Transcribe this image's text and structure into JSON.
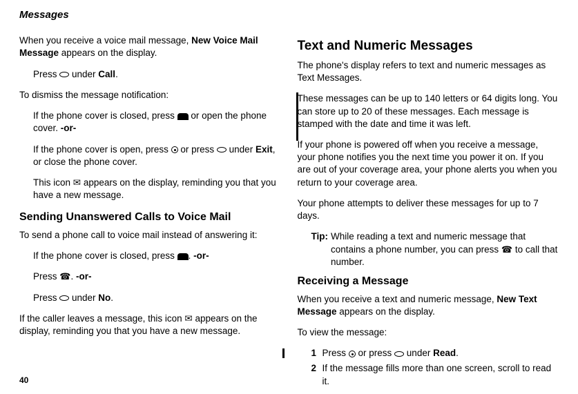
{
  "header": "Messages",
  "left": {
    "p1_a": "When you receive a voice mail message, ",
    "p1_b": "New Voice Mail Message",
    "p1_c": " appears on the display.",
    "l1_a": "Press ",
    "l1_b": " under ",
    "l1_c": "Call",
    "l1_d": ".",
    "p2": "To dismiss the message notification:",
    "l2_a": "If the phone cover is closed, press ",
    "l2_b": " or open the phone cover. ",
    "l2_or": "-or-",
    "l3_a": "If the phone cover is open, press ",
    "l3_b": " or press ",
    "l3_c": " under ",
    "l3_d": "Exit",
    "l3_e": ", or close the phone cover.",
    "l4_a": "This icon ",
    "l4_b": " appears on the display, reminding you that you have a new message.",
    "h2": "Sending Unanswered Calls to Voice Mail",
    "p3": "To send a phone call to voice mail instead of answering it:",
    "l5_a": "If the phone cover is closed, press ",
    "l5_b": ". ",
    "l5_or": "-or-",
    "l6_a": "Press ",
    "l6_b": ". ",
    "l6_or": "-or-",
    "l7_a": "Press ",
    "l7_b": " under ",
    "l7_c": "No",
    "l7_d": ".",
    "p4_a": "If the caller leaves a message, this icon ",
    "p4_b": " appears on the display, reminding you that you have a new message."
  },
  "right": {
    "h1": "Text and Numeric Messages",
    "p1": "The phone's display refers to text and numeric messages as Text Messages.",
    "p2": "These messages can be up to 140 letters or 64 digits long. You can store up to 20 of these messages. Each message is stamped with the date and time it was left.",
    "p3": "If your phone is powered off when you receive a message, your phone notifies you the next time you power it on. If you are out of your coverage area, your phone alerts you when you return to your coverage area.",
    "p4": "Your phone attempts to deliver these messages for up to 7 days.",
    "tip_label": "Tip:",
    "tip_a": "While reading a text and numeric message that contains a phone number, you can press ",
    "tip_b": " to call that number.",
    "h2": "Receiving a Message",
    "p5_a": "When you receive a text and numeric message, ",
    "p5_b": "New Text Message",
    "p5_c": " appears on the display.",
    "p6": "To view the message:",
    "step1_a": "Press ",
    "step1_b": " or press ",
    "step1_c": " under ",
    "step1_d": "Read",
    "step1_e": ".",
    "step2": "If the message fills more than one screen, scroll to read it.",
    "num1": "1",
    "num2": "2"
  },
  "page_number": "40"
}
